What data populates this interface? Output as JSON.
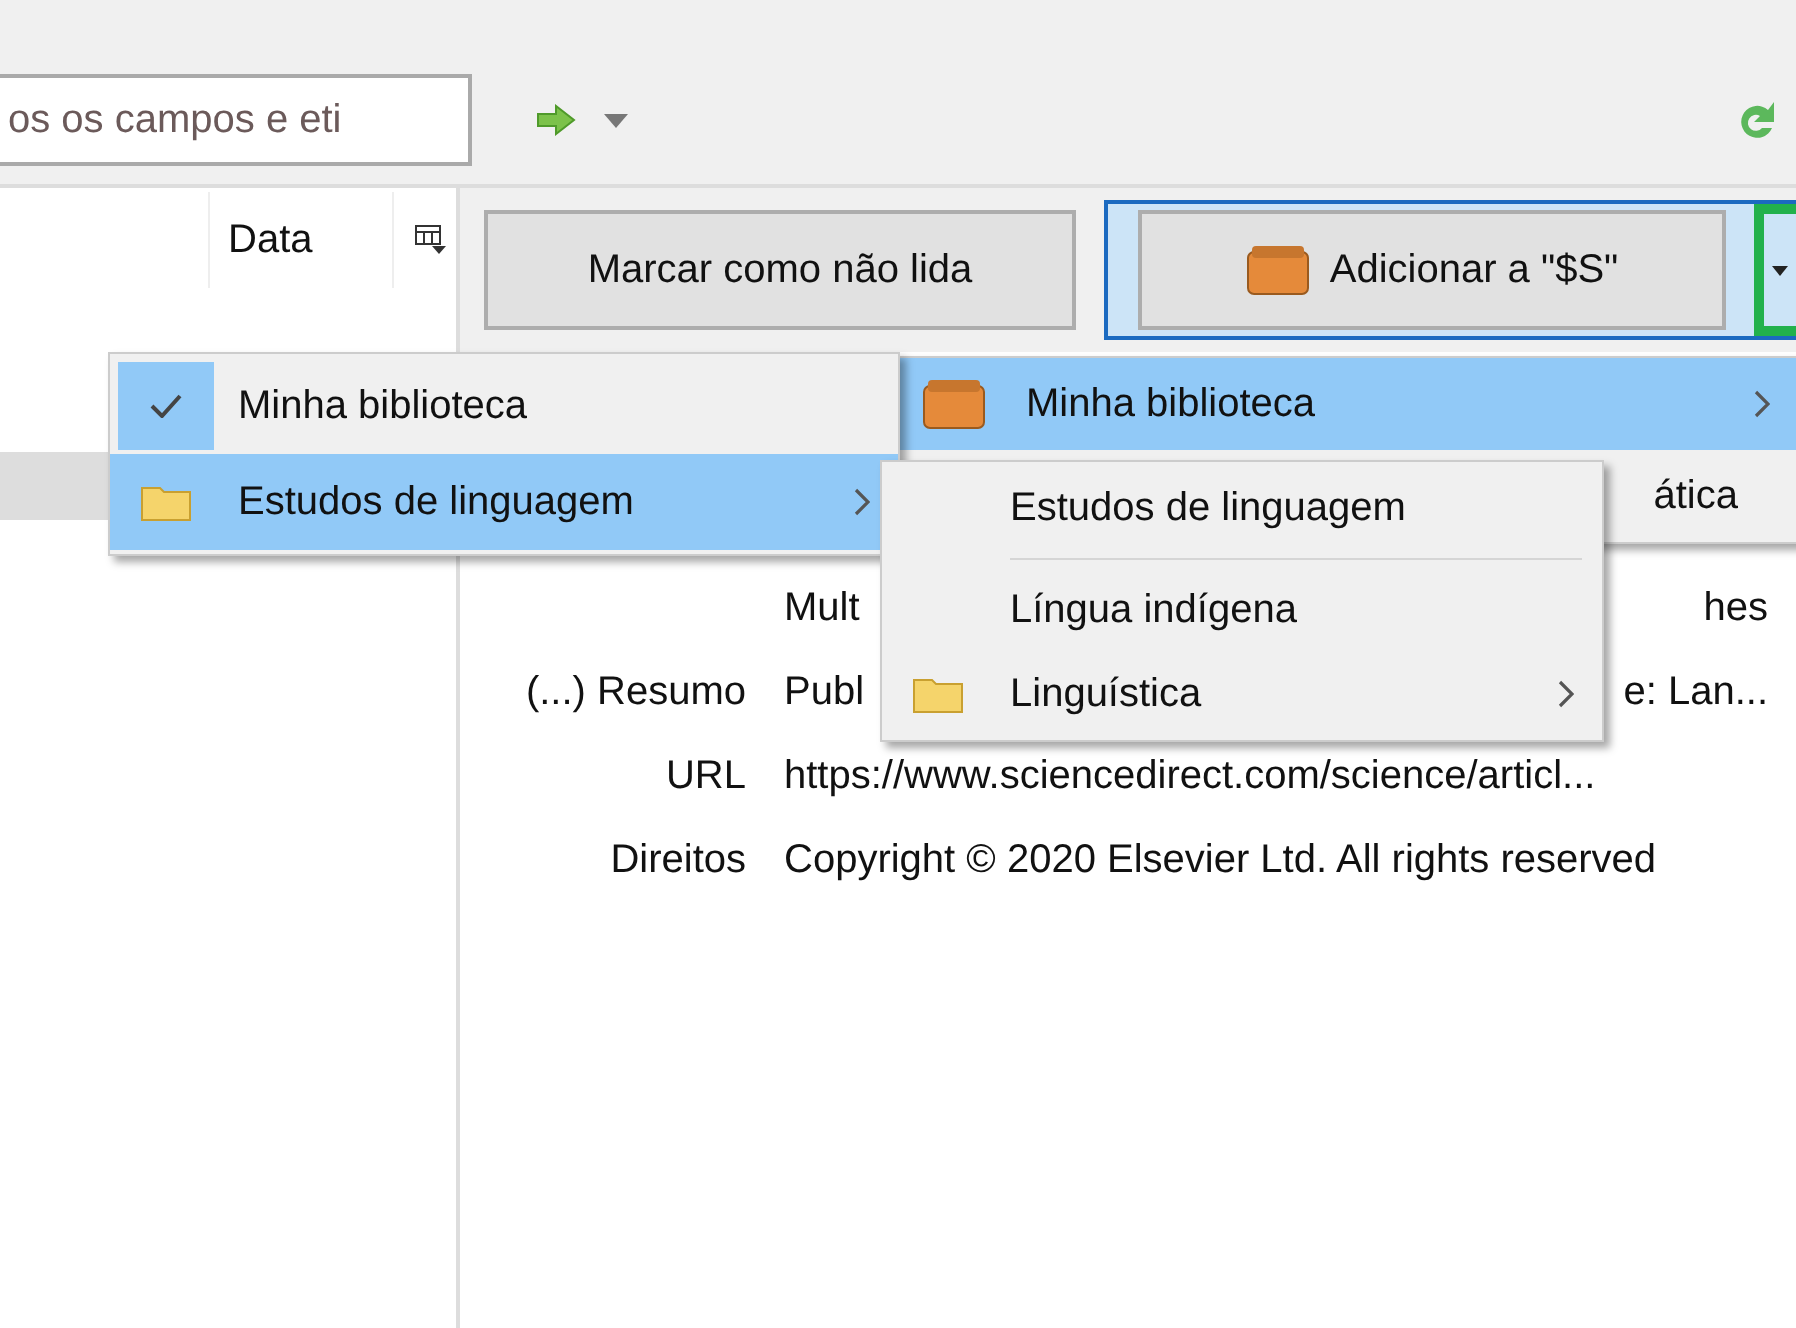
{
  "search": {
    "placeholder": "os os campos e eti"
  },
  "item_list": {
    "columns": [
      "Data"
    ],
    "rows": [
      {
        "selected": true
      }
    ]
  },
  "buttons": {
    "mark_unread": "Marcar como não lida",
    "add_to": "Adicionar a \"$S\""
  },
  "fields": [
    {
      "value_start": "Mult",
      "value_end": "hes"
    },
    {
      "label": "(...) Resumo",
      "value_start": "Publ",
      "value_end": "e: Lan..."
    },
    {
      "label": "URL",
      "value": "https://www.sciencedirect.com/science/articl..."
    },
    {
      "label": "Direitos",
      "value": "Copyright © 2020 Elsevier Ltd. All rights reserved"
    }
  ],
  "add_menu": {
    "items": [
      {
        "kind": "library",
        "label": "Minha biblioteca",
        "selected": true,
        "has_submenu": true
      },
      {
        "kind": "plain",
        "label": "ática",
        "selected": false,
        "has_submenu": false
      }
    ]
  },
  "library_menu": {
    "items": [
      {
        "kind": "plain",
        "label": "Minha biblioteca",
        "checked": true,
        "selected": false,
        "has_submenu": false
      },
      {
        "kind": "folder",
        "label": "Estudos de linguagem",
        "checked": false,
        "selected": true,
        "has_submenu": true
      }
    ]
  },
  "folder_menu": {
    "items": [
      {
        "kind": "plain",
        "label": "Estudos de linguagem",
        "has_submenu": false
      },
      {
        "kind": "separator"
      },
      {
        "kind": "plain",
        "label": "Língua indígena",
        "has_submenu": false
      },
      {
        "kind": "folder",
        "label": "Linguística",
        "has_submenu": true
      }
    ]
  }
}
